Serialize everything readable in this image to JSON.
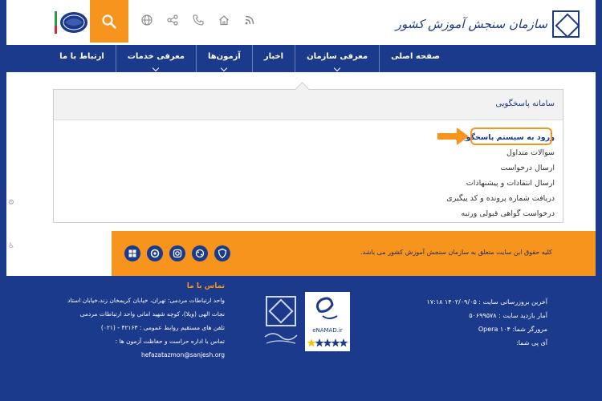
{
  "header": {
    "logo_text": "سازمان سنجش آموزش کشور",
    "icons": [
      "globe-icon",
      "share-icon",
      "phone-icon",
      "home-icon",
      "rss-icon"
    ],
    "search_icon": "search-icon"
  },
  "nav": {
    "items": [
      {
        "label": "صفحه اصلی",
        "dropdown": false
      },
      {
        "label": "معرفی سازمان",
        "dropdown": true
      },
      {
        "label": "اخبار",
        "dropdown": false
      },
      {
        "label": "آزمون‌ها",
        "dropdown": true
      },
      {
        "label": "معرفی خدمات",
        "dropdown": true
      },
      {
        "label": "ارتباط با ما",
        "dropdown": false
      }
    ]
  },
  "panel": {
    "title": "سامانه پاسخگویی",
    "items": [
      {
        "label": "ورود به سیستم پاسخگویی",
        "active": true
      },
      {
        "label": "سوالات متداول",
        "active": false
      },
      {
        "label": "ارسال درخواست",
        "active": false
      },
      {
        "label": "ارسال انتقادات و پیشنهادات",
        "active": false
      },
      {
        "label": "دریافت شماره پرونده و کد پیگیری",
        "active": false
      },
      {
        "label": "درخواست گواهی قبولی ورتبه",
        "active": false
      }
    ]
  },
  "orange_bar": {
    "copyright": "کلیه حقوق این سایت متعلق به سازمان سنجش آموزش کشور می باشد.",
    "social": [
      "windows-icon",
      "firefox-icon",
      "instagram-icon",
      "aparat-icon",
      "shield-icon"
    ]
  },
  "footer": {
    "contact_title": "تماس با ما",
    "contact_lines": [
      "واحد ارتباطات مردمی: تهران، خیابان کریمخان زند،خیابان استاد",
      "نجات الهی (ویلا)، کوچه شهید امانی واحد ارتباطات مردمی",
      "تلفن های مستقیم روابط عمومی : ۴۲۱۶۳ - (۰۲۱)",
      "تماس با اداره حراست و حفاظت آزمون ها :",
      "hefazatazmon@sanjesh.org"
    ],
    "stats": [
      "آخرین بروزرسانی سایت : ۱۴۰۲/۰۹/۰۵ ۱۷:۱۸",
      "آمار بازدید سایت : ۵۰۶۹۹۵۷۸",
      "مرورگر شما: Opera ۱۰۴",
      "آی پی شما:"
    ],
    "enamad_label": "eNAMAD.ir"
  },
  "colors": {
    "primary": "#1b3a8c",
    "accent": "#f7941d"
  }
}
